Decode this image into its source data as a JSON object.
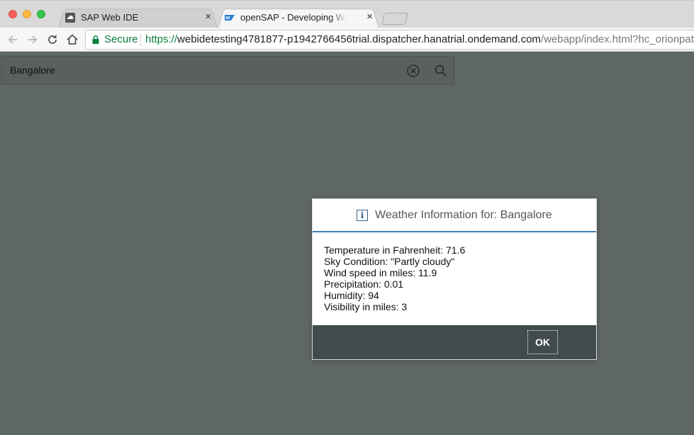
{
  "browser": {
    "tabs": [
      {
        "title": "SAP Web IDE",
        "close": "×",
        "active": false
      },
      {
        "title": "openSAP - Developing Web Ap",
        "close": "×",
        "active": true
      }
    ],
    "address": {
      "secure_label": "Secure",
      "url_scheme": "https://",
      "url_host": "webidetesting4781877-p1942766456trial.dispatcher.hanatrial.ondemand.com",
      "url_path": "/webapp/index.html?hc_orionpat"
    }
  },
  "search": {
    "value": "Bangalore"
  },
  "dialog": {
    "title": "Weather Information for: Bangalore",
    "lines": [
      "Temperature in Fahrenheit: 71.6",
      "Sky Condition: \"Partly cloudy\"",
      "Wind speed in miles: 11.9",
      "Precipitation: 0.01",
      "Humidity: 94",
      "Visibility in miles: 3"
    ],
    "ok_label": "OK"
  },
  "colors": {
    "page_background": "#5f6666",
    "dialog_accent": "#427cac",
    "footer": "#414a4c",
    "secure_green": "#0b8043"
  },
  "icons": {
    "info": "info-icon",
    "clear": "clear-icon",
    "search": "search-icon",
    "lock": "lock-icon"
  }
}
